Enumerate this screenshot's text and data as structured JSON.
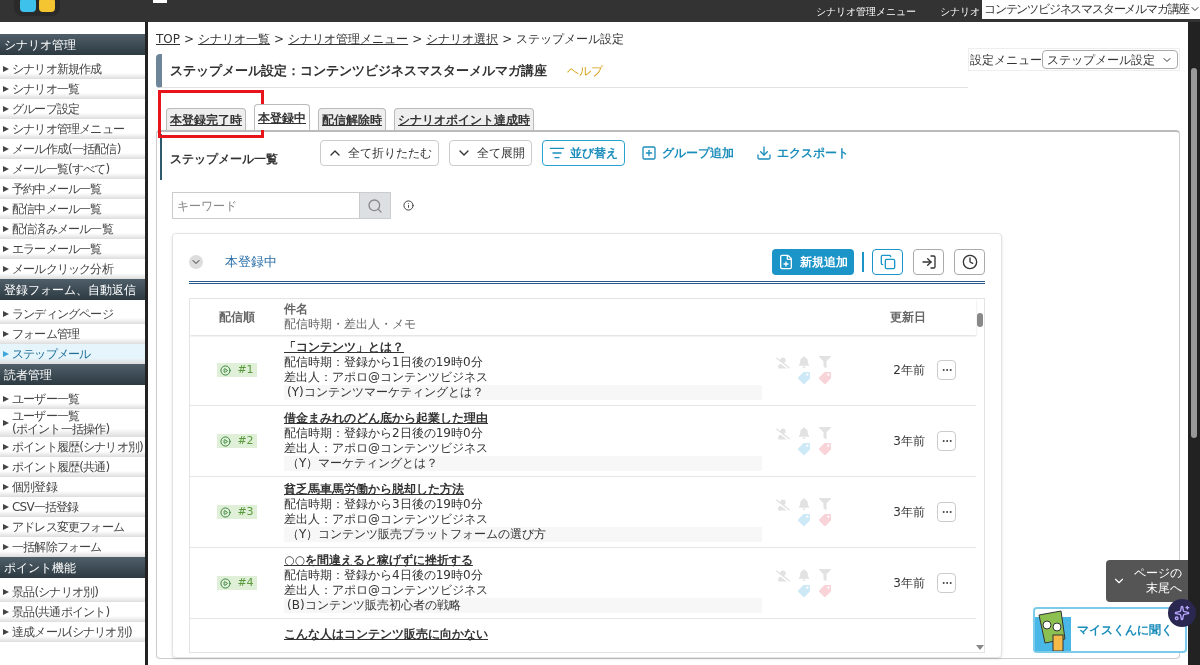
{
  "topbar": {
    "menu_link": "シナリオ管理メニュー",
    "scenario_label": "シナリオ",
    "scenario_select": "コンテンツビジネスマスターメルマガ講座"
  },
  "sidebar": [
    {
      "title": "シナリオ管理",
      "items": [
        {
          "label": "シナリオ新規作成",
          "selected": false
        },
        {
          "label": "シナリオ一覧",
          "selected": false
        },
        {
          "label": "グループ設定",
          "selected": false
        },
        {
          "label": "シナリオ管理メニュー",
          "selected": false
        },
        {
          "label": "メール作成(一括配信)",
          "selected": false
        },
        {
          "label": "メール一覧(すべて)",
          "selected": false
        },
        {
          "label": "予約中メール一覧",
          "selected": false
        },
        {
          "label": "配信中メール一覧",
          "selected": false
        },
        {
          "label": "配信済みメール一覧",
          "selected": false
        },
        {
          "label": "エラーメール一覧",
          "selected": false
        },
        {
          "label": "メールクリック分析",
          "selected": false
        }
      ]
    },
    {
      "title": "登録フォーム、自動返信",
      "items": [
        {
          "label": "ランディングページ",
          "selected": false
        },
        {
          "label": "フォーム管理",
          "selected": false
        },
        {
          "label": "ステップメール",
          "selected": true
        }
      ]
    },
    {
      "title": "読者管理",
      "items": [
        {
          "label": "ユーザー一覧",
          "selected": false
        },
        {
          "label": "ユーザー一覧\n(ポイント一括操作)",
          "selected": false
        },
        {
          "label": "ポイント履歴(シナリオ別)",
          "selected": false
        },
        {
          "label": "ポイント履歴(共通)",
          "selected": false
        },
        {
          "label": "個別登録",
          "selected": false
        },
        {
          "label": "CSV一括登録",
          "selected": false
        },
        {
          "label": "アドレス変更フォーム",
          "selected": false
        },
        {
          "label": "一括解除フォーム",
          "selected": false
        }
      ]
    },
    {
      "title": "ポイント機能",
      "items": [
        {
          "label": "景品(シナリオ別)",
          "selected": false
        },
        {
          "label": "景品(共通ポイント)",
          "selected": false
        },
        {
          "label": "達成メール(シナリオ別)",
          "selected": false
        }
      ]
    }
  ],
  "breadcrumb": [
    {
      "label": "TOP",
      "link": true
    },
    {
      "label": "シナリオ一覧",
      "link": true
    },
    {
      "label": "シナリオ管理メニュー",
      "link": true
    },
    {
      "label": "シナリオ選択",
      "link": true
    },
    {
      "label": "ステップメール設定",
      "link": false
    }
  ],
  "breadcrumb_separator": ">",
  "page_title": "ステップメール設定：コンテンツビジネスマスターメルマガ講座",
  "help_link": "ヘルプ",
  "settings_menu": {
    "label": "設定メニュー",
    "value": "ステップメール設定"
  },
  "tabs": [
    {
      "label": "本登録完了時",
      "selected": false,
      "highlighted": true
    },
    {
      "label": "本登録中",
      "selected": true,
      "highlighted": false
    },
    {
      "label": "配信解除時",
      "selected": false,
      "highlighted": false
    },
    {
      "label": "シナリオポイント達成時",
      "selected": false,
      "highlighted": false
    }
  ],
  "list_title": "ステップメール一覧",
  "toolbar": [
    {
      "label": "全て折りたたむ",
      "kind": "collapse"
    },
    {
      "label": "全て展開",
      "kind": "expand"
    },
    {
      "label": "並び替え",
      "kind": "sort"
    },
    {
      "label": "グループ追加",
      "kind": "group_add"
    },
    {
      "label": "エクスポート",
      "kind": "export"
    }
  ],
  "search": {
    "placeholder": "キーワード"
  },
  "group": {
    "name": "本登録中",
    "expanded": true,
    "add_button": "新規追加"
  },
  "columns": {
    "order": "配信順",
    "subject": "件名",
    "subject_sub": "配信時期・差出人・メモ",
    "updated": "更新日"
  },
  "rows": [
    {
      "number": "#1",
      "title": "「コンテンツ」とは？",
      "timing": "配信時期：登録から1日後の19時0分",
      "sender": "差出人：アポロ@コンテンツビジネス",
      "memo": "(Y)コンテンツマーケティングとは？",
      "updated": "2年前"
    },
    {
      "number": "#2",
      "title": "借金まみれのどん底から起業した理由",
      "timing": "配信時期：登録から2日後の19時0分",
      "sender": "差出人：アポロ@コンテンツビジネス",
      "memo": "（Y）マーケティングとは？",
      "updated": "3年前"
    },
    {
      "number": "#3",
      "title": "貧乏馬車馬労働から脱却した方法",
      "timing": "配信時期：登録から3日後の19時0分",
      "sender": "差出人：アポロ@コンテンツビジネス",
      "memo": "（Y）コンテンツ販売プラットフォームの選び方",
      "updated": "3年前"
    },
    {
      "number": "#4",
      "title": "○○を間違えると稼げずに挫折する",
      "timing": "配信時期：登録から4日後の19時0分",
      "sender": "差出人：アポロ@コンテンツビジネス",
      "memo": "(B)コンテンツ販売初心者の戦略",
      "updated": "3年前"
    }
  ],
  "partial_row_title": "こんな人はコンテンツ販売に向かない",
  "page_end_button": [
    "ページの",
    "末尾へ"
  ],
  "assistant_button": "マイスくんに聞く"
}
